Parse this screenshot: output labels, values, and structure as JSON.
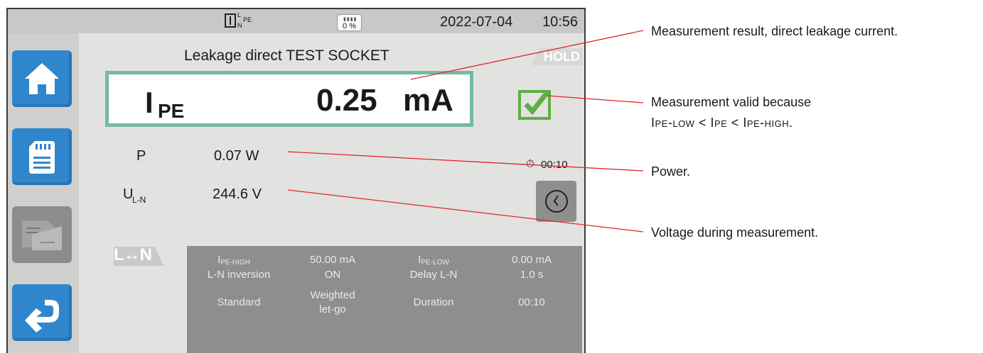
{
  "status_bar": {
    "lnpe_L": "L",
    "lnpe_N": "N",
    "lnpe_PE": "PE",
    "sd_percent": "0 %",
    "date": "2022-07-04",
    "time": "10:56"
  },
  "sidebar": {
    "items": [
      {
        "icon": "home-icon"
      },
      {
        "icon": "sd-card-icon"
      },
      {
        "icon": "records-icon"
      },
      {
        "icon": "back-arrow-icon"
      }
    ]
  },
  "screen": {
    "title": "Leakage direct TEST SOCKET",
    "hold": "HOLD",
    "result_symbol": "I",
    "result_symbol_sub": "PE",
    "result_value": "0.25",
    "result_unit": "mA",
    "power_label": "P",
    "power_value": "0.07 W",
    "voltage_label": "U",
    "voltage_sub": "L-N",
    "voltage_value": "244.6 V",
    "timer": "00:10",
    "ln_badge": "L↔N"
  },
  "params": {
    "rows": [
      [
        "I",
        "PE-HIGH",
        "50.00 mA",
        "I",
        "PE-LOW",
        "0.00 mA"
      ],
      [
        "L-N inversion",
        "ON",
        "Delay L-N",
        "1.0 s"
      ],
      [
        "Standard",
        "Weighted",
        "let-go",
        "Duration",
        "00:10"
      ]
    ]
  },
  "annotations": {
    "result": "Measurement result, direct leakage current.",
    "valid_1": "Measurement valid because",
    "valid_2": "Ipe-low < Ipe < Ipe-high.",
    "power": "Power.",
    "voltage": "Voltage during measurement."
  },
  "colors": {
    "accent_blue": "#2f86cc",
    "valid_green": "#5fae44",
    "result_border": "#74b9a6",
    "annotation_line": "#e0262c"
  }
}
